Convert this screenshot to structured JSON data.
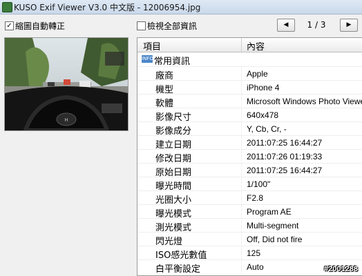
{
  "window": {
    "title": "KUSO Exif Viewer V3.0 中文版 - 12006954.jpg"
  },
  "options": {
    "shrink_rotate": {
      "label": "縮圖自動轉正",
      "checked": true
    },
    "view_all": {
      "label": "檢視全部資訊",
      "checked": false
    }
  },
  "nav": {
    "prev_icon": "prev-arrow-icon",
    "next_icon": "next-arrow-icon",
    "page": "1 / 3"
  },
  "grid": {
    "col_item": "項目",
    "col_content": "內容",
    "group": "常用資訊",
    "group_icon_text": "INFO",
    "rows": [
      {
        "k": "廠商",
        "v": "Apple"
      },
      {
        "k": "機型",
        "v": "iPhone 4"
      },
      {
        "k": "軟體",
        "v": "Microsoft Windows Photo Viewer"
      },
      {
        "k": "影像尺寸",
        "v": "640x478"
      },
      {
        "k": "影像成分",
        "v": "Y, Cb, Cr, -"
      },
      {
        "k": "建立日期",
        "v": "2011:07:25 16:44:27"
      },
      {
        "k": "修改日期",
        "v": "2011:07:26 01:19:33"
      },
      {
        "k": "原始日期",
        "v": "2011:07:25 16:44:27"
      },
      {
        "k": "曝光時間",
        "v": "1/100\""
      },
      {
        "k": "光圈大小",
        "v": "F2.8"
      },
      {
        "k": "曝光模式",
        "v": "Program AE"
      },
      {
        "k": "測光模式",
        "v": "Multi-segment"
      },
      {
        "k": "閃光燈",
        "v": "Off, Did not fire"
      },
      {
        "k": "ISO感光數值",
        "v": "125"
      },
      {
        "k": "白平衡設定",
        "v": "Auto"
      }
    ]
  },
  "watermark": "#2001288"
}
